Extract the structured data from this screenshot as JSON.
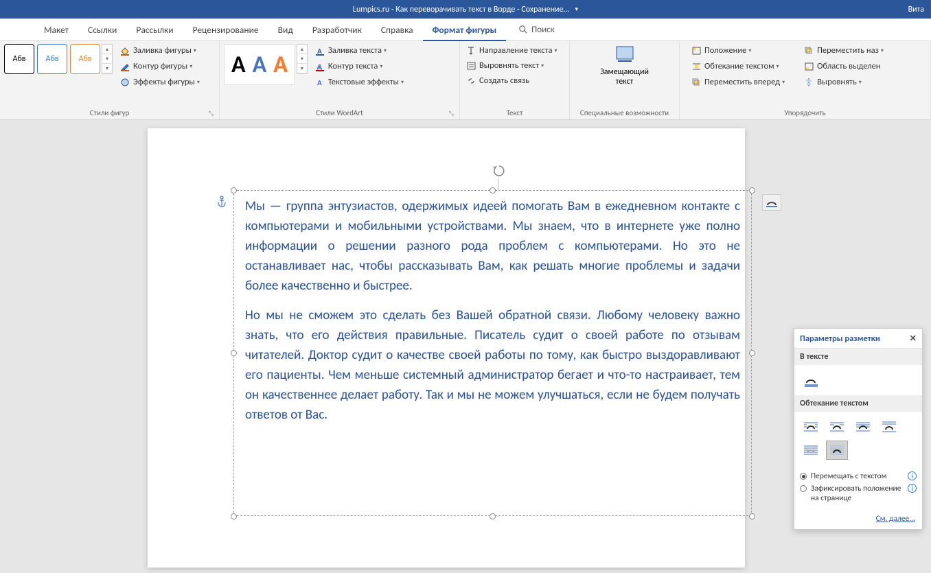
{
  "titlebar": {
    "title": "Lumpics.ru - Как переворачивать текст в Ворде  -  Сохранение...",
    "user": "Вита"
  },
  "tabs": {
    "layout": "Макет",
    "references": "Ссылки",
    "mailings": "Рассылки",
    "review": "Рецензирование",
    "view": "Вид",
    "developer": "Разработчик",
    "help": "Справка",
    "shape_format": "Формат фигуры",
    "search": "Поиск"
  },
  "ribbon": {
    "shape_styles": {
      "sample": "Абв",
      "fill": "Заливка фигуры",
      "outline": "Контур фигуры",
      "effects": "Эффекты фигуры",
      "group": "Стили фигур"
    },
    "wordart": {
      "text_fill": "Заливка текста",
      "text_outline": "Контур текста",
      "text_effects": "Текстовые эффекты",
      "group": "Стили WordArt"
    },
    "text": {
      "direction": "Направление текста",
      "align": "Выровнять текст",
      "link": "Создать связь",
      "group": "Текст"
    },
    "access": {
      "alt_text": "Замещающий текст",
      "group": "Специальные возможности"
    },
    "arrange": {
      "position": "Положение",
      "wrap": "Обтекание текстом",
      "forward": "Переместить вперед",
      "backward": "Переместить наз",
      "selection": "Область выделен",
      "align": "Выровнять",
      "group": "Упорядочить"
    }
  },
  "document": {
    "p1": "Мы — группа энтузиастов, одержимых идеей помогать Вам в ежедневном контакте с компьютерами и мобильными устройствами. Мы знаем, что в интернете уже полно информации о решении разного рода проблем с компьютерами. Но это не останавливает нас, чтобы рассказывать Вам, как решать многие проблемы и задачи более качественно и быстрее.",
    "p2": "Но мы не сможем это сделать без Вашей обратной связи. Любому человеку важно знать, что его действия правильные. Писатель судит о своей работе по отзывам читателей. Доктор судит о качестве своей работы по тому, как быстро выздоравливают его пациенты. Чем меньше системный администратор бегает и что-то настраивает, тем он качественнее делает работу. Так и мы не можем улучшаться, если не будем получать ответов от Вас."
  },
  "layout_pane": {
    "title": "Параметры разметки",
    "in_text": "В тексте",
    "wrap": "Обтекание текстом",
    "move_with": "Перемещать с текстом",
    "fix_pos": "Зафиксировать положение на странице",
    "see_more": "См. далее..."
  }
}
